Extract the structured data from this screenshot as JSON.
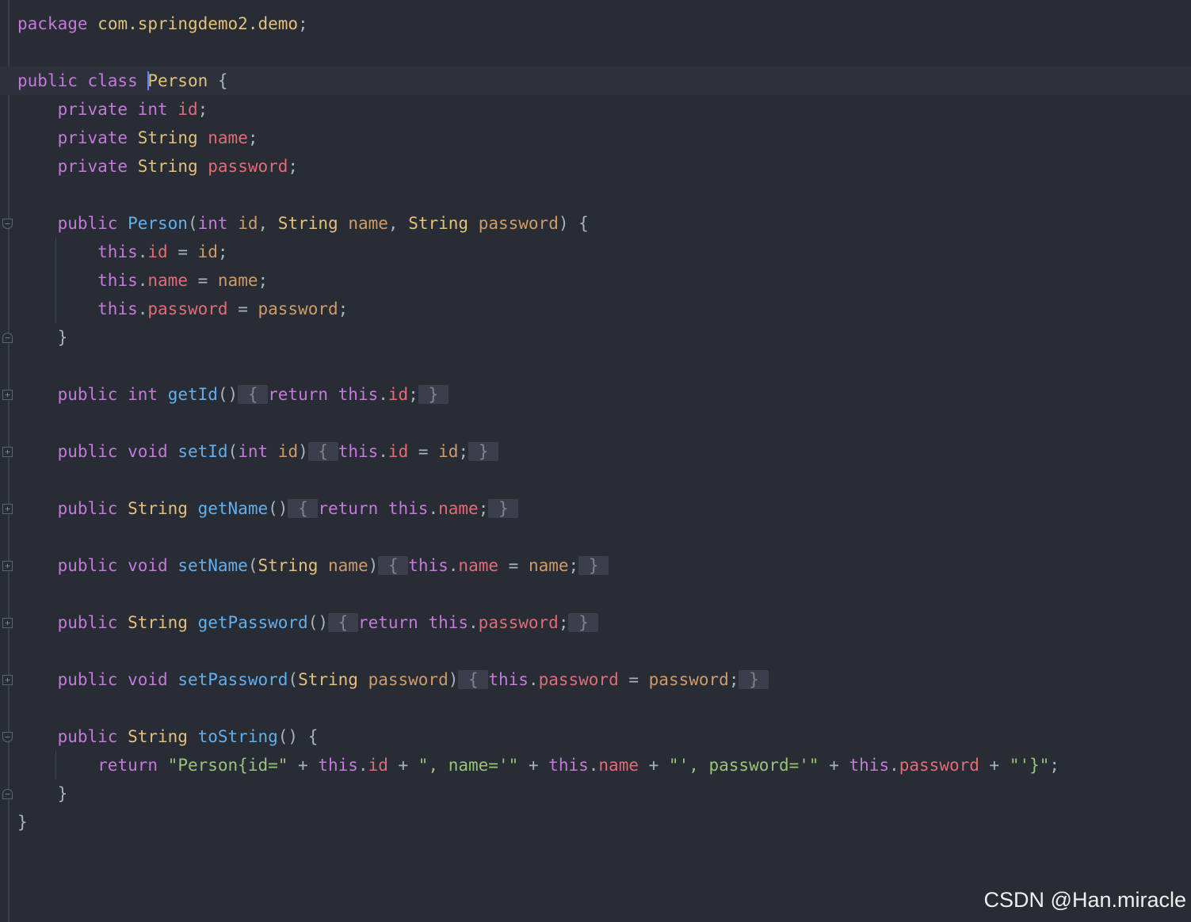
{
  "code": {
    "package_kw": "package",
    "package_name": "com.springdemo2.demo",
    "semicolon": ";",
    "class_decl": {
      "mods": "public class",
      "name": "Person",
      "open": "{"
    },
    "fields": [
      {
        "mod": "private",
        "type": "int",
        "name": "id"
      },
      {
        "mod": "private",
        "type": "String",
        "name": "name"
      },
      {
        "mod": "private",
        "type": "String",
        "name": "password"
      }
    ],
    "constructor": {
      "mod": "public",
      "name": "Person",
      "params": [
        {
          "type": "int",
          "name": "id"
        },
        {
          "type": "String",
          "name": "name"
        },
        {
          "type": "String",
          "name": "password"
        }
      ],
      "body": [
        {
          "this": "this",
          "field": "id",
          "value": "id"
        },
        {
          "this": "this",
          "field": "name",
          "value": "name"
        },
        {
          "this": "this",
          "field": "password",
          "value": "password"
        }
      ]
    },
    "getId": {
      "mod": "public",
      "type": "int",
      "name": "getId",
      "ret": "return",
      "this": "this",
      "field": "id"
    },
    "setId": {
      "mod": "public",
      "type": "void",
      "name": "setId",
      "ptype": "int",
      "pname": "id",
      "this": "this",
      "field": "id",
      "value": "id"
    },
    "getName": {
      "mod": "public",
      "type": "String",
      "name": "getName",
      "ret": "return",
      "this": "this",
      "field": "name"
    },
    "setName": {
      "mod": "public",
      "type": "void",
      "name": "setName",
      "ptype": "String",
      "pname": "name",
      "this": "this",
      "field": "name",
      "value": "name"
    },
    "getPassword": {
      "mod": "public",
      "type": "String",
      "name": "getPassword",
      "ret": "return",
      "this": "this",
      "field": "password"
    },
    "setPassword": {
      "mod": "public",
      "type": "void",
      "name": "setPassword",
      "ptype": "String",
      "pname": "password",
      "this": "this",
      "field": "password",
      "value": "password"
    },
    "toString": {
      "mod": "public",
      "type": "String",
      "name": "toString",
      "ret": "return",
      "s1": "\"Person{id=\"",
      "s2": "\", name='\"",
      "s3": "\"', password='\"",
      "s4": "\"'}\"",
      "this": "this",
      "f1": "id",
      "f2": "name",
      "f3": "password"
    },
    "close": "}"
  },
  "watermark": "CSDN @Han.miracle",
  "colors": {
    "background": "#282c34",
    "keyword": "#c678dd",
    "type": "#e5c07b",
    "function": "#61afef",
    "field": "#e06c75",
    "parameter": "#d19a66",
    "string": "#98c379",
    "caret": "#528bff"
  },
  "icons": [
    "fold-open-icon",
    "fold-close-icon",
    "fold-collapsed-icon"
  ]
}
